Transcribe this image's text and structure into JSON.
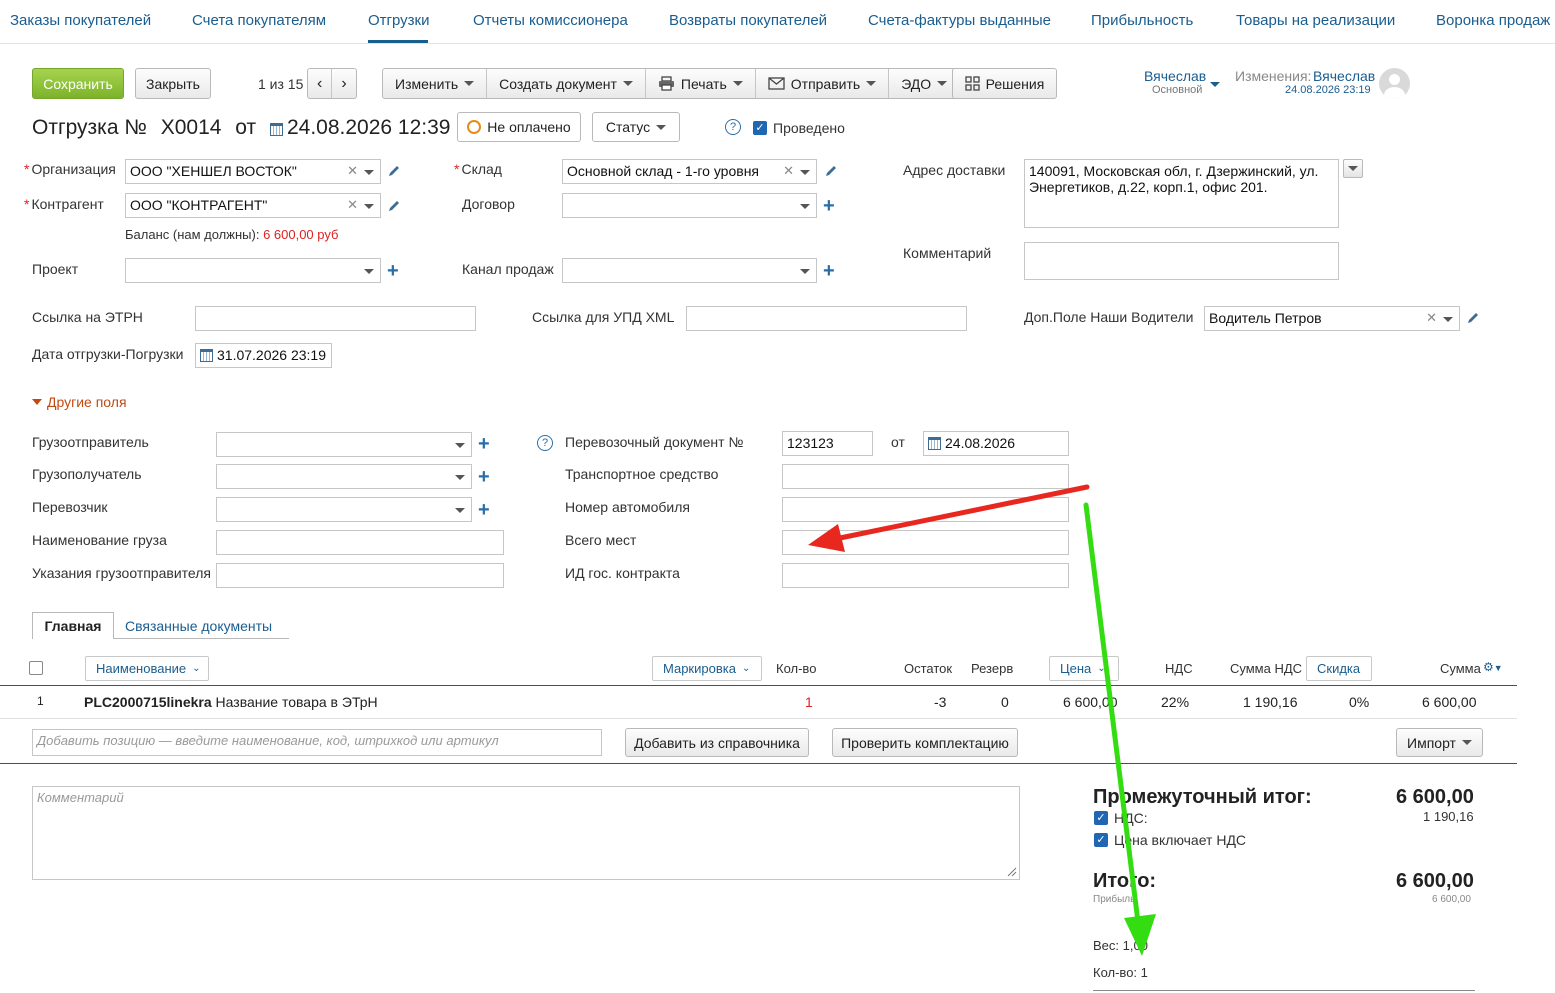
{
  "nav": {
    "items": [
      "Заказы покупателей",
      "Счета покупателям",
      "Отгрузки",
      "Отчеты комиссионера",
      "Возвраты покупателей",
      "Счета-фактуры выданные",
      "Прибыльность",
      "Товары на реализации",
      "Воронка продаж"
    ]
  },
  "toolbar": {
    "save": "Сохранить",
    "close": "Закрыть",
    "pager": "1 из 15",
    "edit": "Изменить",
    "create_doc": "Создать документ",
    "print": "Печать",
    "send": "Отправить",
    "edo": "ЭДО",
    "solutions": "Решения"
  },
  "user": {
    "name": "Вячеслав",
    "role": "Основной",
    "changes_label": "Изменения:",
    "changes_user": "Вячеслав",
    "changes_date": "24.08.2026 23:19"
  },
  "doc": {
    "title_prefix": "Отгрузка №",
    "number": "Х0014",
    "from": "от",
    "datetime": "24.08.2026 12:39",
    "payment_status": "Не оплачено",
    "status_btn": "Статус",
    "posted_label": "Проведено"
  },
  "form": {
    "org_label": "Организация",
    "org_value": "ООО \"ХЕНШЕЛ ВОСТОК\"",
    "counterparty_label": "Контрагент",
    "counterparty_value": "ООО \"КОНТРАГЕНТ\"",
    "balance_label": "Баланс (нам должны):",
    "balance_value": "6 600,00 руб",
    "project_label": "Проект",
    "warehouse_label": "Склад",
    "warehouse_value": "Основной склад - 1-го уровня",
    "contract_label": "Договор",
    "channel_label": "Канал продаж",
    "address_label": "Адрес доставки",
    "address_value": "140091, Московская обл, г. Дзержинский,  ул. Энергетиков, д.22, корп.1, офис 201.",
    "comment_label": "Комментарий",
    "etrn_label": "Ссылка на ЭТРН",
    "upd_label": "Ссылка для УПД XML",
    "drivers_label": "Доп.Поле Наши Водители",
    "drivers_value": "Водитель Петров",
    "ship_date_label": "Дата отгрузки-Погрузки",
    "ship_date_value": "31.07.2026 23:19",
    "other_fields": "Другие поля"
  },
  "other": {
    "shipper": "Грузоотправитель",
    "consignee": "Грузополучатель",
    "carrier": "Перевозчик",
    "cargo_name": "Наименование груза",
    "shipper_notes": "Указания грузоотправителя",
    "transport_doc_label": "Перевозочный документ №",
    "transport_doc_value": "123123",
    "transport_doc_from": "от",
    "transport_doc_date": "24.08.2026",
    "vehicle": "Транспортное средство",
    "car_number": "Номер автомобиля",
    "places_total": "Всего мест",
    "contract_id": "ИД гос. контракта"
  },
  "tabs": [
    "Главная",
    "Связанные документы"
  ],
  "table": {
    "headers": {
      "name": "Наименование",
      "marking": "Маркировка",
      "qty": "Кол-во",
      "stock": "Остаток",
      "reserve": "Резерв",
      "price": "Цена",
      "vat": "НДС",
      "vat_sum": "Сумма НДС",
      "discount": "Скидка",
      "sum": "Сумма"
    },
    "rows": [
      {
        "n": "1",
        "code": "PLC2000715linekra",
        "name": "Название товара в ЭТрН",
        "qty": "1",
        "stock": "-3",
        "reserve": "0",
        "price": "6 600,00",
        "vat": "22%",
        "vat_sum": "1 190,16",
        "discount": "0%",
        "sum": "6 600,00"
      }
    ],
    "add_placeholder": "Добавить позицию — введите наименование, код, штрихкод или артикул",
    "add_from_catalog": "Добавить из справочника",
    "check_kit": "Проверить комплектацию",
    "import": "Импорт"
  },
  "footer": {
    "comment_placeholder": "Комментарий",
    "subtotal_label": "Промежуточный итог:",
    "subtotal_value": "6 600,00",
    "vat_label": "НДС:",
    "vat_value": "1 190,16",
    "price_incl_vat": "Цена включает НДС",
    "total_label": "Итого:",
    "total_value": "6 600,00",
    "profit_label": "Прибыль",
    "profit_value": "6 600,00",
    "weight": "Вес: 1,00",
    "qty": "Кол-во: 1"
  },
  "colors": {
    "accent": "#1a5d8f",
    "save_green": "#8bc34a",
    "red_arrow": "#e8281e",
    "green_arrow": "#33dd11",
    "negative": "#d22"
  }
}
